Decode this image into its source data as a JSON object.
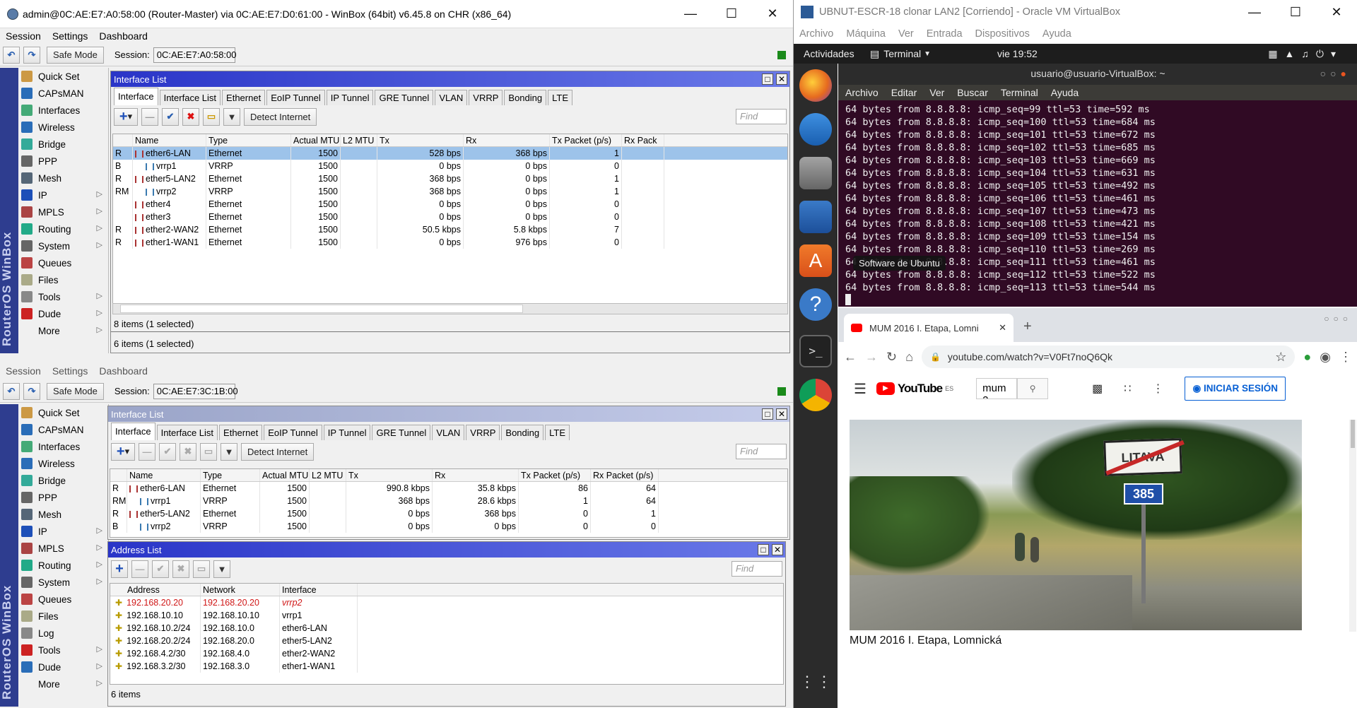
{
  "winbox": {
    "title": "admin@0C:AE:E7:A0:58:00 (Router-Master) via 0C:AE:E7:D0:61:00 - WinBox (64bit) v6.45.8 on CHR (x86_64)",
    "menu": [
      "Session",
      "Settings",
      "Dashboard"
    ],
    "safe_mode": "Safe Mode",
    "session_label": "Session:",
    "session1": "0C:AE:E7:A0:58:00",
    "session2": "0C:AE:E7:3C:1B:00",
    "brand": "RouterOS WinBox",
    "sidebar1": [
      "Quick Set",
      "CAPsMAN",
      "Interfaces",
      "Wireless",
      "Bridge",
      "PPP",
      "Mesh",
      "IP",
      "MPLS",
      "Routing",
      "System",
      "Queues",
      "Files",
      "Tools",
      "Dude",
      "More"
    ],
    "sidebar2": [
      "Quick Set",
      "CAPsMAN",
      "Interfaces",
      "Wireless",
      "Bridge",
      "PPP",
      "Mesh",
      "IP",
      "MPLS",
      "Routing",
      "System",
      "Queues",
      "Files",
      "Log",
      "Tools",
      "Dude",
      "More"
    ],
    "iface_title": "Interface List",
    "tabs": [
      "Interface",
      "Interface List",
      "Ethernet",
      "EoIP Tunnel",
      "IP Tunnel",
      "GRE Tunnel",
      "VLAN",
      "VRRP",
      "Bonding",
      "LTE"
    ],
    "detect": "Detect Internet",
    "find": "Find",
    "cols1": [
      "",
      "Name",
      "Type",
      "Actual MTU",
      "L2 MTU",
      "Tx",
      "Rx",
      "Tx Packet (p/s)",
      "Rx Pack"
    ],
    "cols2": [
      "",
      "Name",
      "Type",
      "Actual MTU",
      "L2 MTU",
      "Tx",
      "Rx",
      "Tx Packet (p/s)",
      "Rx Packet (p/s)"
    ],
    "rows1": [
      [
        "R",
        "ether6-LAN",
        "Ethernet",
        "1500",
        "",
        "528 bps",
        "368 bps",
        "1",
        ""
      ],
      [
        "B",
        "vrrp1",
        "VRRP",
        "1500",
        "",
        "0 bps",
        "0 bps",
        "0",
        ""
      ],
      [
        "R",
        "ether5-LAN2",
        "Ethernet",
        "1500",
        "",
        "368 bps",
        "0 bps",
        "1",
        ""
      ],
      [
        "RM",
        "vrrp2",
        "VRRP",
        "1500",
        "",
        "368 bps",
        "0 bps",
        "1",
        ""
      ],
      [
        "",
        "ether4",
        "Ethernet",
        "1500",
        "",
        "0 bps",
        "0 bps",
        "0",
        ""
      ],
      [
        "",
        "ether3",
        "Ethernet",
        "1500",
        "",
        "0 bps",
        "0 bps",
        "0",
        ""
      ],
      [
        "R",
        "ether2-WAN2",
        "Ethernet",
        "1500",
        "",
        "50.5 kbps",
        "5.8 kbps",
        "7",
        ""
      ],
      [
        "R",
        "ether1-WAN1",
        "Ethernet",
        "1500",
        "",
        "0 bps",
        "976 bps",
        "0",
        ""
      ]
    ],
    "rows2": [
      [
        "R",
        "ether6-LAN",
        "Ethernet",
        "1500",
        "",
        "990.8 kbps",
        "35.8 kbps",
        "86",
        "64"
      ],
      [
        "RM",
        "vrrp1",
        "VRRP",
        "1500",
        "",
        "368 bps",
        "28.6 kbps",
        "1",
        "64"
      ],
      [
        "R",
        "ether5-LAN2",
        "Ethernet",
        "1500",
        "",
        "0 bps",
        "368 bps",
        "0",
        "1"
      ],
      [
        "B",
        "vrrp2",
        "VRRP",
        "1500",
        "",
        "0 bps",
        "0 bps",
        "0",
        "0"
      ]
    ],
    "status1a": "8 items (1 selected)",
    "status1b": "6 items (1 selected)",
    "addr_title": "Address List",
    "addr_cols": [
      "Address",
      "Network",
      "Interface"
    ],
    "addr_rows": [
      [
        "192.168.20.20",
        "192.168.20.20",
        "vrrp2"
      ],
      [
        "192.168.10.10",
        "192.168.10.10",
        "vrrp1"
      ],
      [
        "192.168.10.2/24",
        "192.168.10.0",
        "ether6-LAN"
      ],
      [
        "192.168.20.2/24",
        "192.168.20.0",
        "ether5-LAN2"
      ],
      [
        "192.168.4.2/30",
        "192.168.4.0",
        "ether2-WAN2"
      ],
      [
        "192.168.3.2/30",
        "192.168.3.0",
        "ether1-WAN1"
      ]
    ],
    "addr_status": "6 items"
  },
  "vbox": {
    "title": "UBNUT-ESCR-18 clonar LAN2 [Corriendo] - Oracle VM VirtualBox",
    "menu": [
      "Archivo",
      "Máquina",
      "Ver",
      "Entrada",
      "Dispositivos",
      "Ayuda"
    ],
    "activities": "Actividades",
    "terminal_app": "Terminal",
    "clock": "vie 19:52",
    "term_title": "usuario@usuario-VirtualBox: ~",
    "term_menu": [
      "Archivo",
      "Editar",
      "Ver",
      "Buscar",
      "Terminal",
      "Ayuda"
    ],
    "ping_lines": [
      "64 bytes from 8.8.8.8: icmp_seq=99 ttl=53 time=592 ms",
      "64 bytes from 8.8.8.8: icmp_seq=100 ttl=53 time=684 ms",
      "64 bytes from 8.8.8.8: icmp_seq=101 ttl=53 time=672 ms",
      "64 bytes from 8.8.8.8: icmp_seq=102 ttl=53 time=685 ms",
      "64 bytes from 8.8.8.8: icmp_seq=103 ttl=53 time=669 ms",
      "64 bytes from 8.8.8.8: icmp_seq=104 ttl=53 time=631 ms",
      "64 bytes from 8.8.8.8: icmp_seq=105 ttl=53 time=492 ms",
      "64 bytes from 8.8.8.8: icmp_seq=106 ttl=53 time=461 ms",
      "64 bytes from 8.8.8.8: icmp_seq=107 ttl=53 time=473 ms",
      "64 bytes from 8.8.8.8: icmp_seq=108 ttl=53 time=421 ms",
      "64 bytes from 8.8.8.8: icmp_seq=109 ttl=53 time=154 ms",
      "64 bytes from 8.8.8.8: icmp_seq=110 ttl=53 time=269 ms",
      "64 bytes from 8.8.8.8: icmp_seq=111 ttl=53 time=461 ms",
      "64 bytes from 8.8.8.8: icmp_seq=112 ttl=53 time=522 ms",
      "64 bytes from 8.8.8.8: icmp_seq=113 ttl=53 time=544 ms"
    ],
    "tooltip": "Software de Ubuntu",
    "chrome_tab": "MUM 2016 I. Etapa, Lomni",
    "url": "youtube.com/watch?v=V0Ft7noQ6Qk",
    "yt_logo": "YouTube",
    "yt_region": "ES",
    "yt_search": "mum 2",
    "signin": "INICIAR SESIÓN",
    "video_title": "MUM 2016 I. Etapa, Lomnická",
    "sign_text": "LITAVA",
    "road_num": "385"
  }
}
